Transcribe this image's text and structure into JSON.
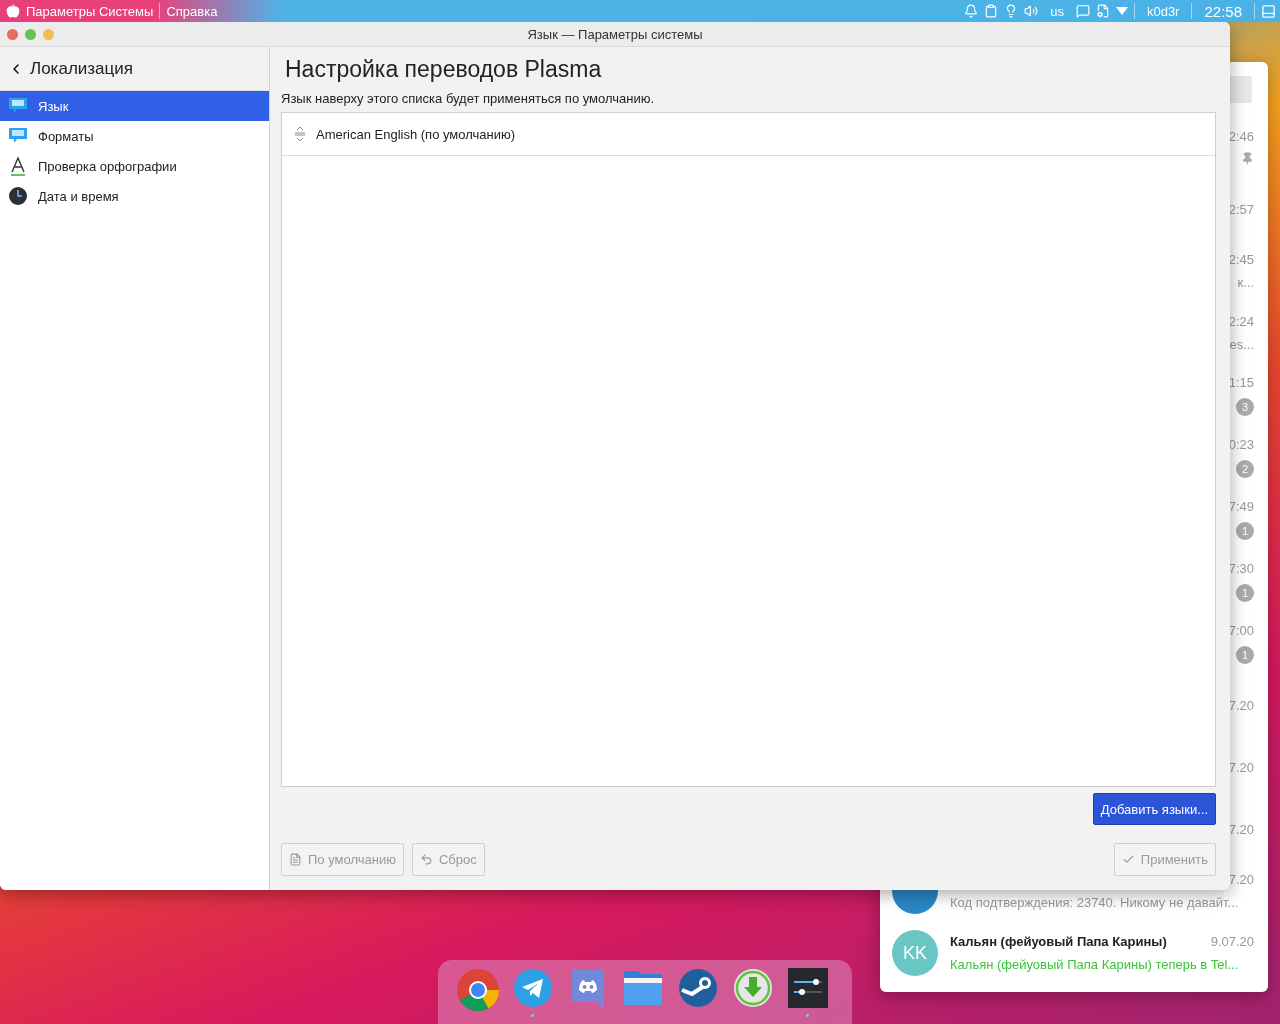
{
  "top_bar": {
    "app_menu": [
      {
        "label": "Параметры Системы"
      },
      {
        "label": "Справка"
      }
    ],
    "keyboard_layout": "us",
    "user": "k0d3r",
    "clock": "22:58"
  },
  "window": {
    "title": "Язык — Параметры системы",
    "sidebar": {
      "back_title": "Локализация",
      "items": [
        {
          "label": "Язык",
          "kind": "speech",
          "selected": true
        },
        {
          "label": "Форматы",
          "kind": "speech",
          "selected": false
        },
        {
          "label": "Проверка орфографии",
          "kind": "spell",
          "selected": false
        },
        {
          "label": "Дата и время",
          "kind": "clock",
          "selected": false
        }
      ]
    },
    "heading": "Настройка переводов Plasma",
    "hint": "Язык наверху этого списка будет применяться по умолчанию.",
    "languages": [
      {
        "label": "American English (по умолчанию)"
      }
    ],
    "add_button": "Добавить языки...",
    "footer_buttons": [
      {
        "label": "По умолчанию",
        "kind": "defaults",
        "disabled": true
      },
      {
        "label": "Сброс",
        "kind": "reset",
        "disabled": true
      },
      {
        "label": "Применить",
        "kind": "apply",
        "disabled": true
      }
    ]
  },
  "telegram": {
    "strip": [
      {
        "time": "2:46",
        "pinned": true
      },
      {
        "time": "2:57",
        "pinned": false
      },
      {
        "time": "2:45",
        "pinned": false,
        "snippet": "к..."
      },
      {
        "time": "2:24",
        "pinned": false,
        "snippet": "es..."
      },
      {
        "time": "1:15",
        "pinned": false,
        "badge": "3"
      },
      {
        "time": "0:23",
        "pinned": false,
        "badge": "2"
      },
      {
        "time": "7:49",
        "pinned": false,
        "badge": "1"
      },
      {
        "time": "7:30",
        "pinned": false,
        "badge": "1"
      },
      {
        "time": "7:00",
        "pinned": false,
        "badge": "1"
      },
      {
        "time": "7.20",
        "pinned": false
      },
      {
        "time": "7.20",
        "pinned": false
      },
      {
        "time": "7.20",
        "pinned": false
      }
    ],
    "chats": [
      {
        "kind": "channel",
        "time": "7.20",
        "message": "Код подтверждения: 23740. Никому не давайт...",
        "highlighted": false
      },
      {
        "kind": "contact",
        "avatar": "KK",
        "title": "Кальян (фейуовый Папа Карины)",
        "time": "9.07.20",
        "message": "Кальян (фейуовый Папа Карины) теперь в Tel...",
        "highlighted": true
      }
    ]
  },
  "dock": {
    "apps": [
      {
        "kind": "browser",
        "running": false
      },
      {
        "kind": "messenger",
        "running": true
      },
      {
        "kind": "chat",
        "running": false
      },
      {
        "kind": "files",
        "running": false
      },
      {
        "kind": "games",
        "running": false
      },
      {
        "kind": "download",
        "running": false
      },
      {
        "kind": "settings",
        "running": true
      }
    ]
  }
}
